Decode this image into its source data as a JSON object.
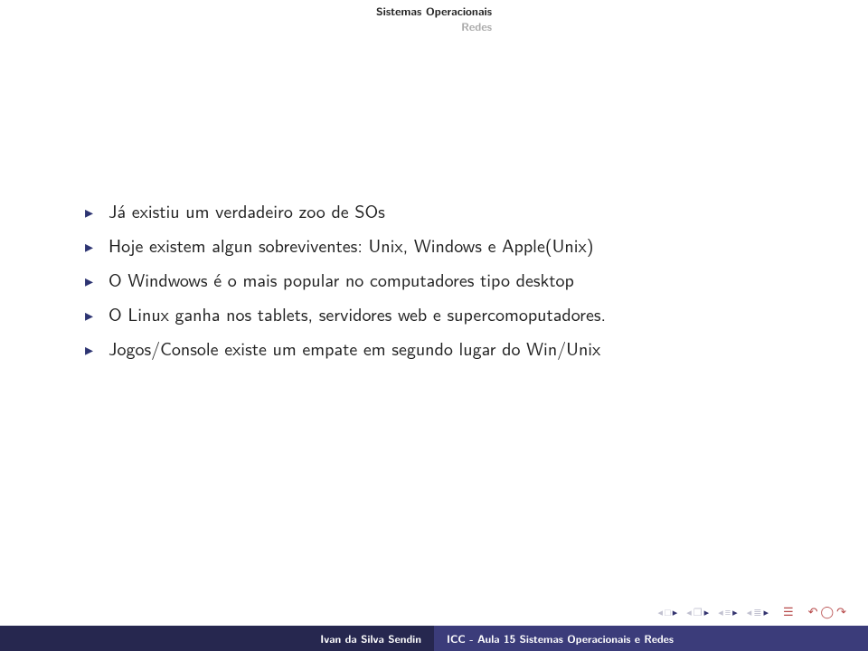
{
  "header": {
    "line1": "Sistemas Operacionais",
    "line2": "Redes"
  },
  "bullets": [
    "Já existiu um verdadeiro zoo de SOs",
    "Hoje existem algun sobreviventes: Unix, Windows e Apple(Unix)",
    "O Windwows é o mais popular no computadores tipo desktop",
    "O Linux ganha nos tablets, servidores web e supercomoputadores.",
    "Jogos/Console existe um empate em segundo lugar do Win/Unix"
  ],
  "footer": {
    "author": "Ivan da Silva Sendin",
    "title": "ICC - Aula 15 Sistemas Operacionais e Redes"
  }
}
